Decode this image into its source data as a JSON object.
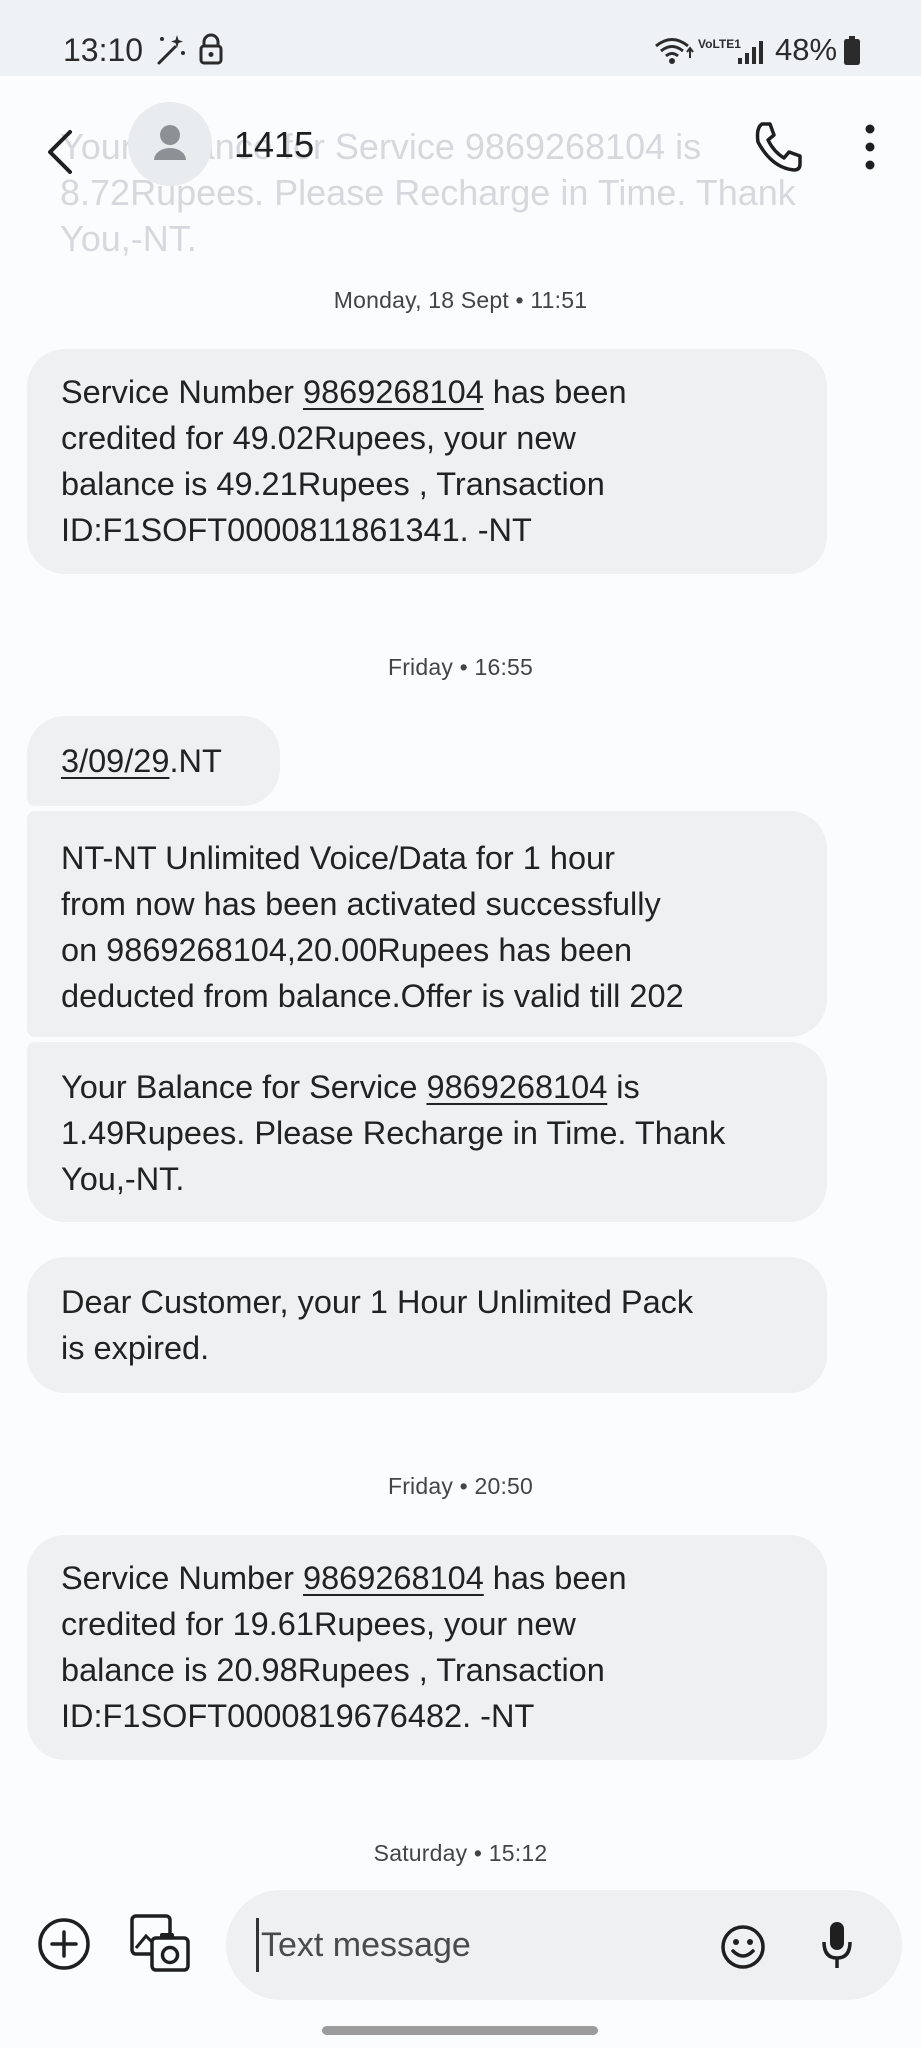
{
  "status_bar": {
    "time": "13:10",
    "network_label": "VoLTE1",
    "battery_percent": "48%"
  },
  "background_preview": {
    "lines": [
      "Your Balance for Service 9869268104 is",
      "8.72Rupees. Please Recharge in Time. Thank",
      "You,-NT."
    ]
  },
  "header": {
    "back_icon": "back-arrow-icon",
    "contact_name": "1415",
    "call_icon": "phone-icon",
    "more_icon": "more-vert-icon"
  },
  "conversation": {
    "timestamps": [
      "Monday, 18 Sept • 11:51",
      "Friday • 16:55",
      "Friday • 20:50",
      "Saturday • 15:12"
    ],
    "messages": [
      {
        "lines": [
          [
            "Service Number ",
            "9869268104",
            " has been"
          ],
          [
            "credited for 49.02Rupees, your new"
          ],
          [
            "balance is 49.21Rupees , Transaction"
          ],
          [
            "ID:F1SOFT0000811861341. -NT"
          ]
        ]
      },
      {
        "lines": [
          [
            "",
            "3/09/29",
            ".NT"
          ]
        ]
      },
      {
        "lines": [
          [
            "NT-NT Unlimited Voice/Data for 1 hour"
          ],
          [
            "from now  has been activated successfully"
          ],
          [
            "on 9869268104,20.00Rupees has been"
          ],
          [
            "deducted from balance.Offer is valid till 202"
          ]
        ]
      },
      {
        "lines": [
          [
            "Your Balance for Service ",
            "9869268104",
            " is"
          ],
          [
            "1.49Rupees. Please Recharge in Time. Thank"
          ],
          [
            "You,-NT."
          ]
        ]
      },
      {
        "lines": [
          [
            "Dear Customer, your 1 Hour Unlimited Pack"
          ],
          [
            "is expired."
          ]
        ]
      },
      {
        "lines": [
          [
            "Service Number ",
            "9869268104",
            " has been"
          ],
          [
            "credited for 19.61Rupees, your new"
          ],
          [
            "balance is 20.98Rupees , Transaction"
          ],
          [
            "ID:F1SOFT0000819676482. -NT"
          ]
        ]
      }
    ]
  },
  "compose": {
    "placeholder": "Text message",
    "add_icon": "add-circle-icon",
    "gallery_icon": "gallery-icon",
    "emoji_icon": "emoji-icon",
    "mic_icon": "mic-icon"
  }
}
